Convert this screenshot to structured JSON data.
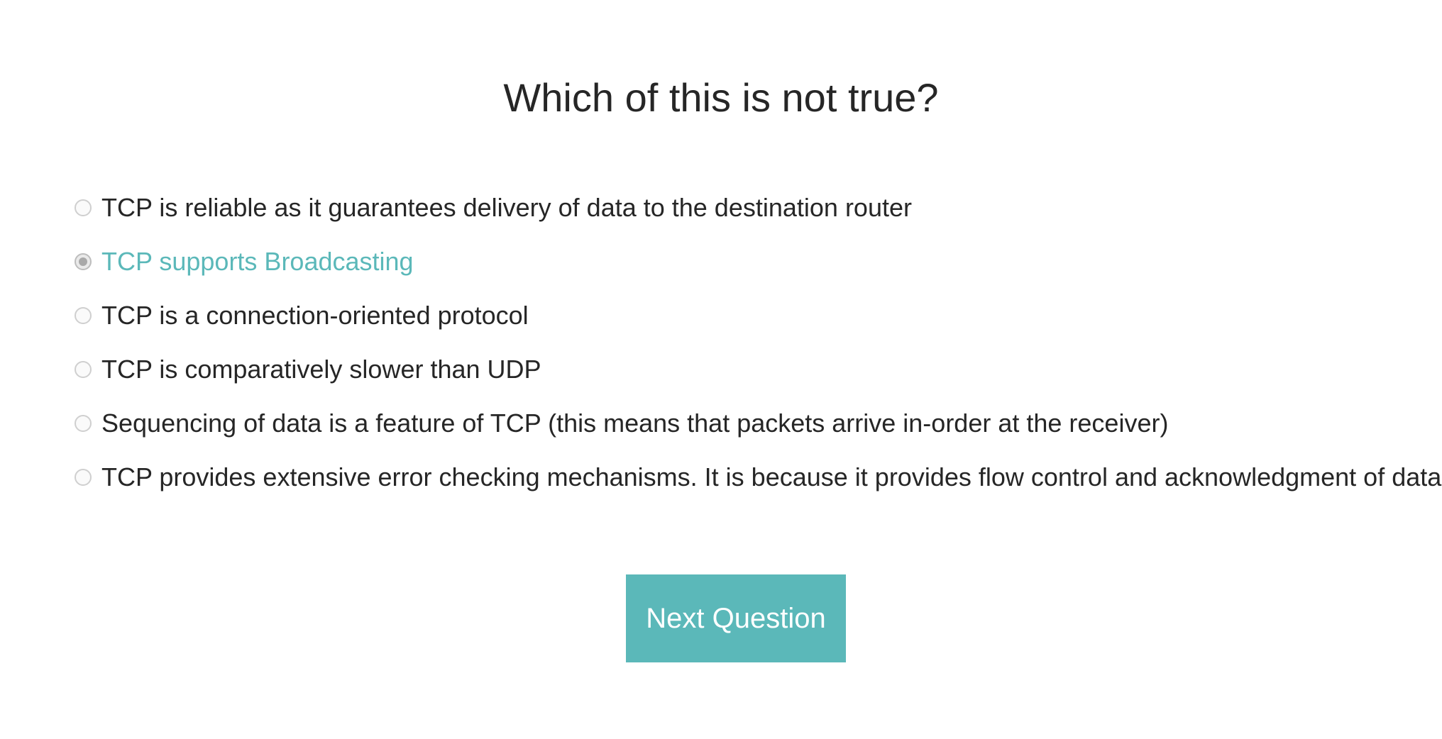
{
  "question": {
    "title": "Which of this is not true?"
  },
  "options": [
    {
      "label": "TCP is reliable as it guarantees delivery of data to the destination router",
      "selected": false
    },
    {
      "label": "TCP supports Broadcasting",
      "selected": true
    },
    {
      "label": "TCP is a connection-oriented protocol",
      "selected": false
    },
    {
      "label": "TCP is comparatively slower than UDP",
      "selected": false
    },
    {
      "label": "Sequencing of data is a feature of TCP (this means that packets arrive in-order at the receiver)",
      "selected": false
    },
    {
      "label": "TCP provides extensive error checking mechanisms. It is because it provides flow control and acknowledgment of data",
      "selected": false
    }
  ],
  "next_button": {
    "label": "Next Question"
  },
  "colors": {
    "accent": "#5bb8b9",
    "text": "#262626",
    "background": "#ffffff"
  }
}
